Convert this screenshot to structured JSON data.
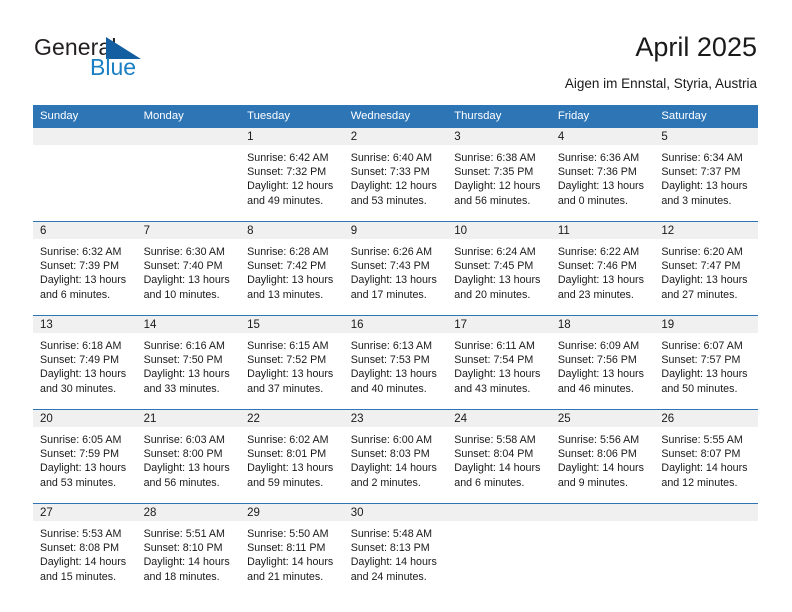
{
  "brand": {
    "name_part1": "General",
    "name_part2": "Blue",
    "accent_color": "#125ea0",
    "blue_text_color": "#1b7fc4"
  },
  "header": {
    "title": "April 2025",
    "subtitle": "Aigen im Ennstal, Styria, Austria"
  },
  "calendar": {
    "header_bg": "#2e75b6",
    "daynum_band_bg": "#f0f0f0",
    "weekday_headers": [
      "Sunday",
      "Monday",
      "Tuesday",
      "Wednesday",
      "Thursday",
      "Friday",
      "Saturday"
    ],
    "weeks": [
      [
        {
          "day": "",
          "sunrise": "",
          "sunset": "",
          "daylight_line1": "",
          "daylight_line2": ""
        },
        {
          "day": "",
          "sunrise": "",
          "sunset": "",
          "daylight_line1": "",
          "daylight_line2": ""
        },
        {
          "day": "1",
          "sunrise": "Sunrise: 6:42 AM",
          "sunset": "Sunset: 7:32 PM",
          "daylight_line1": "Daylight: 12 hours",
          "daylight_line2": "and 49 minutes."
        },
        {
          "day": "2",
          "sunrise": "Sunrise: 6:40 AM",
          "sunset": "Sunset: 7:33 PM",
          "daylight_line1": "Daylight: 12 hours",
          "daylight_line2": "and 53 minutes."
        },
        {
          "day": "3",
          "sunrise": "Sunrise: 6:38 AM",
          "sunset": "Sunset: 7:35 PM",
          "daylight_line1": "Daylight: 12 hours",
          "daylight_line2": "and 56 minutes."
        },
        {
          "day": "4",
          "sunrise": "Sunrise: 6:36 AM",
          "sunset": "Sunset: 7:36 PM",
          "daylight_line1": "Daylight: 13 hours",
          "daylight_line2": "and 0 minutes."
        },
        {
          "day": "5",
          "sunrise": "Sunrise: 6:34 AM",
          "sunset": "Sunset: 7:37 PM",
          "daylight_line1": "Daylight: 13 hours",
          "daylight_line2": "and 3 minutes."
        }
      ],
      [
        {
          "day": "6",
          "sunrise": "Sunrise: 6:32 AM",
          "sunset": "Sunset: 7:39 PM",
          "daylight_line1": "Daylight: 13 hours",
          "daylight_line2": "and 6 minutes."
        },
        {
          "day": "7",
          "sunrise": "Sunrise: 6:30 AM",
          "sunset": "Sunset: 7:40 PM",
          "daylight_line1": "Daylight: 13 hours",
          "daylight_line2": "and 10 minutes."
        },
        {
          "day": "8",
          "sunrise": "Sunrise: 6:28 AM",
          "sunset": "Sunset: 7:42 PM",
          "daylight_line1": "Daylight: 13 hours",
          "daylight_line2": "and 13 minutes."
        },
        {
          "day": "9",
          "sunrise": "Sunrise: 6:26 AM",
          "sunset": "Sunset: 7:43 PM",
          "daylight_line1": "Daylight: 13 hours",
          "daylight_line2": "and 17 minutes."
        },
        {
          "day": "10",
          "sunrise": "Sunrise: 6:24 AM",
          "sunset": "Sunset: 7:45 PM",
          "daylight_line1": "Daylight: 13 hours",
          "daylight_line2": "and 20 minutes."
        },
        {
          "day": "11",
          "sunrise": "Sunrise: 6:22 AM",
          "sunset": "Sunset: 7:46 PM",
          "daylight_line1": "Daylight: 13 hours",
          "daylight_line2": "and 23 minutes."
        },
        {
          "day": "12",
          "sunrise": "Sunrise: 6:20 AM",
          "sunset": "Sunset: 7:47 PM",
          "daylight_line1": "Daylight: 13 hours",
          "daylight_line2": "and 27 minutes."
        }
      ],
      [
        {
          "day": "13",
          "sunrise": "Sunrise: 6:18 AM",
          "sunset": "Sunset: 7:49 PM",
          "daylight_line1": "Daylight: 13 hours",
          "daylight_line2": "and 30 minutes."
        },
        {
          "day": "14",
          "sunrise": "Sunrise: 6:16 AM",
          "sunset": "Sunset: 7:50 PM",
          "daylight_line1": "Daylight: 13 hours",
          "daylight_line2": "and 33 minutes."
        },
        {
          "day": "15",
          "sunrise": "Sunrise: 6:15 AM",
          "sunset": "Sunset: 7:52 PM",
          "daylight_line1": "Daylight: 13 hours",
          "daylight_line2": "and 37 minutes."
        },
        {
          "day": "16",
          "sunrise": "Sunrise: 6:13 AM",
          "sunset": "Sunset: 7:53 PM",
          "daylight_line1": "Daylight: 13 hours",
          "daylight_line2": "and 40 minutes."
        },
        {
          "day": "17",
          "sunrise": "Sunrise: 6:11 AM",
          "sunset": "Sunset: 7:54 PM",
          "daylight_line1": "Daylight: 13 hours",
          "daylight_line2": "and 43 minutes."
        },
        {
          "day": "18",
          "sunrise": "Sunrise: 6:09 AM",
          "sunset": "Sunset: 7:56 PM",
          "daylight_line1": "Daylight: 13 hours",
          "daylight_line2": "and 46 minutes."
        },
        {
          "day": "19",
          "sunrise": "Sunrise: 6:07 AM",
          "sunset": "Sunset: 7:57 PM",
          "daylight_line1": "Daylight: 13 hours",
          "daylight_line2": "and 50 minutes."
        }
      ],
      [
        {
          "day": "20",
          "sunrise": "Sunrise: 6:05 AM",
          "sunset": "Sunset: 7:59 PM",
          "daylight_line1": "Daylight: 13 hours",
          "daylight_line2": "and 53 minutes."
        },
        {
          "day": "21",
          "sunrise": "Sunrise: 6:03 AM",
          "sunset": "Sunset: 8:00 PM",
          "daylight_line1": "Daylight: 13 hours",
          "daylight_line2": "and 56 minutes."
        },
        {
          "day": "22",
          "sunrise": "Sunrise: 6:02 AM",
          "sunset": "Sunset: 8:01 PM",
          "daylight_line1": "Daylight: 13 hours",
          "daylight_line2": "and 59 minutes."
        },
        {
          "day": "23",
          "sunrise": "Sunrise: 6:00 AM",
          "sunset": "Sunset: 8:03 PM",
          "daylight_line1": "Daylight: 14 hours",
          "daylight_line2": "and 2 minutes."
        },
        {
          "day": "24",
          "sunrise": "Sunrise: 5:58 AM",
          "sunset": "Sunset: 8:04 PM",
          "daylight_line1": "Daylight: 14 hours",
          "daylight_line2": "and 6 minutes."
        },
        {
          "day": "25",
          "sunrise": "Sunrise: 5:56 AM",
          "sunset": "Sunset: 8:06 PM",
          "daylight_line1": "Daylight: 14 hours",
          "daylight_line2": "and 9 minutes."
        },
        {
          "day": "26",
          "sunrise": "Sunrise: 5:55 AM",
          "sunset": "Sunset: 8:07 PM",
          "daylight_line1": "Daylight: 14 hours",
          "daylight_line2": "and 12 minutes."
        }
      ],
      [
        {
          "day": "27",
          "sunrise": "Sunrise: 5:53 AM",
          "sunset": "Sunset: 8:08 PM",
          "daylight_line1": "Daylight: 14 hours",
          "daylight_line2": "and 15 minutes."
        },
        {
          "day": "28",
          "sunrise": "Sunrise: 5:51 AM",
          "sunset": "Sunset: 8:10 PM",
          "daylight_line1": "Daylight: 14 hours",
          "daylight_line2": "and 18 minutes."
        },
        {
          "day": "29",
          "sunrise": "Sunrise: 5:50 AM",
          "sunset": "Sunset: 8:11 PM",
          "daylight_line1": "Daylight: 14 hours",
          "daylight_line2": "and 21 minutes."
        },
        {
          "day": "30",
          "sunrise": "Sunrise: 5:48 AM",
          "sunset": "Sunset: 8:13 PM",
          "daylight_line1": "Daylight: 14 hours",
          "daylight_line2": "and 24 minutes."
        },
        {
          "day": "",
          "sunrise": "",
          "sunset": "",
          "daylight_line1": "",
          "daylight_line2": ""
        },
        {
          "day": "",
          "sunrise": "",
          "sunset": "",
          "daylight_line1": "",
          "daylight_line2": ""
        },
        {
          "day": "",
          "sunrise": "",
          "sunset": "",
          "daylight_line1": "",
          "daylight_line2": ""
        }
      ]
    ]
  }
}
